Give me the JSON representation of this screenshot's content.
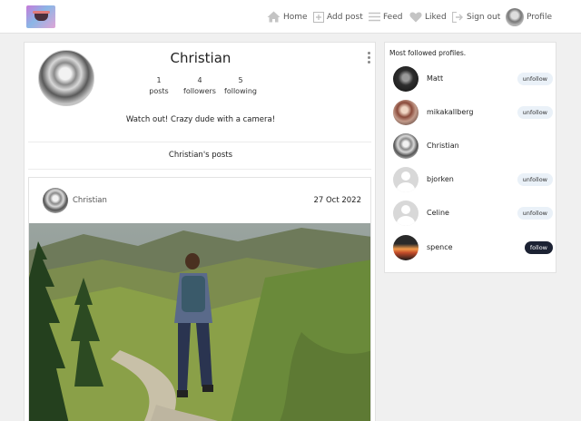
{
  "nav": {
    "items": [
      {
        "label": "Home",
        "icon": "home-icon"
      },
      {
        "label": "Add post",
        "icon": "add-post-icon"
      },
      {
        "label": "Feed",
        "icon": "feed-icon"
      },
      {
        "label": "Liked",
        "icon": "heart-icon"
      },
      {
        "label": "Sign out",
        "icon": "sign-out-icon"
      },
      {
        "label": "Profile",
        "icon": "avatar"
      }
    ]
  },
  "profile": {
    "name": "Christian",
    "stats": [
      {
        "value": "1",
        "label": "posts"
      },
      {
        "value": "4",
        "label": "followers"
      },
      {
        "value": "5",
        "label": "following"
      }
    ],
    "bio": "Watch out! Crazy dude with a camera!",
    "posts_heading": "Christian's posts"
  },
  "post": {
    "author": "Christian",
    "date": "27 Oct 2022"
  },
  "sidebar": {
    "title": "Most followed profiles.",
    "profiles": [
      {
        "name": "Matt",
        "action": "unfollow"
      },
      {
        "name": "mikakallberg",
        "action": "unfollow"
      },
      {
        "name": "Christian",
        "action": ""
      },
      {
        "name": "bjorken",
        "action": "unfollow"
      },
      {
        "name": "Celine",
        "action": "unfollow"
      },
      {
        "name": "spence",
        "action": "follow"
      }
    ]
  },
  "colors": {
    "accent_dark": "#1c2233",
    "pill_light": "#eaf1f8",
    "page_bg": "#f0f0f0"
  }
}
